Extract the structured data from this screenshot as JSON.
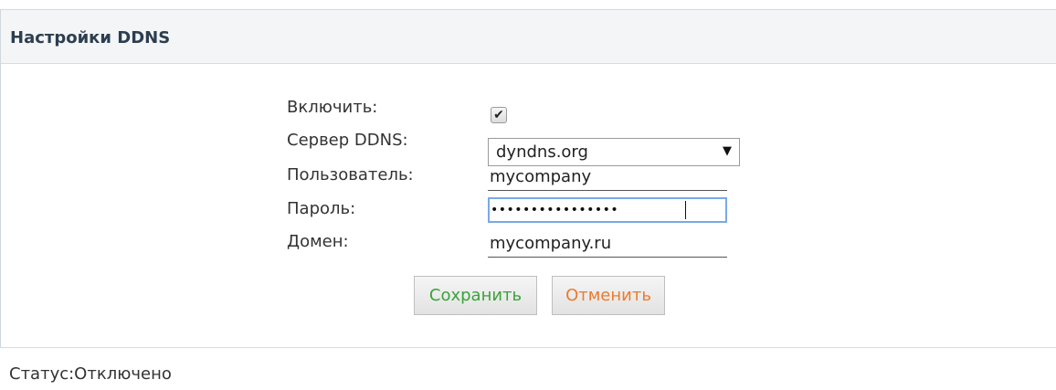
{
  "panel": {
    "title": "Настройки DDNS"
  },
  "form": {
    "enable": {
      "label": "Включить:",
      "checked": true,
      "check_glyph": "✔"
    },
    "server": {
      "label": "Сервер DDNS:",
      "value": "dyndns.org",
      "arrow": "▼"
    },
    "user": {
      "label": "Пользователь:",
      "value": "mycompany"
    },
    "password": {
      "label": "Пароль:",
      "masked": "••••••••••••••••"
    },
    "domain": {
      "label": "Домен:",
      "value": "mycompany.ru"
    }
  },
  "buttons": {
    "save": "Сохранить",
    "cancel": "Отменить"
  },
  "status": {
    "text": "Статус:Отключено"
  },
  "colors": {
    "save_text": "#3aa33a",
    "cancel_text": "#ee7a2b",
    "focus_border": "#7aa8e6"
  }
}
